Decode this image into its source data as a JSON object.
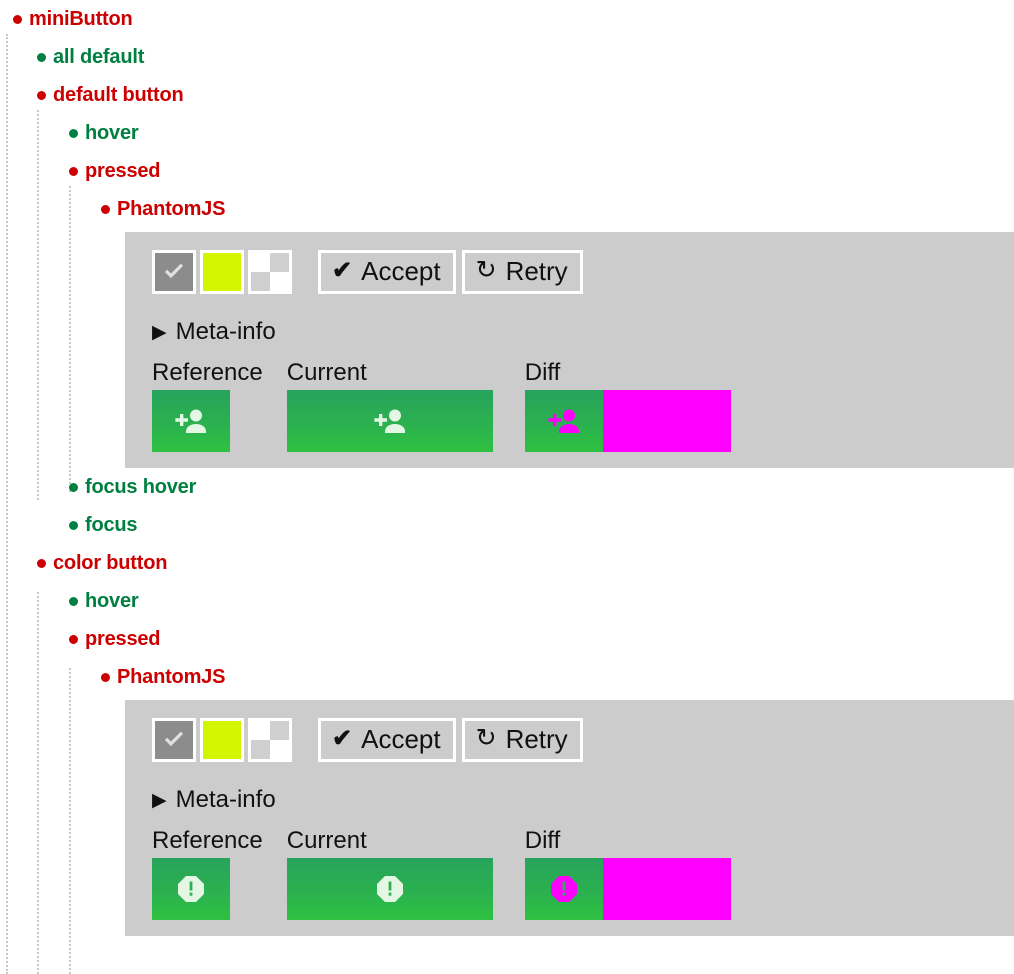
{
  "colors": {
    "fail": "#cc0000",
    "pass": "#008040",
    "panel_bg": "#cccccc",
    "diff_highlight": "#ff00ff",
    "swatch_lime": "#d4f500",
    "swatch_gray": "#8c8c8c",
    "shot_green": "#2bb14f"
  },
  "tree": {
    "root": {
      "label": "miniButton",
      "status": "fail"
    },
    "all_default": {
      "label": "all default",
      "status": "pass"
    },
    "default_button": {
      "label": "default button",
      "status": "fail"
    },
    "default_hover": {
      "label": "hover",
      "status": "pass"
    },
    "default_pressed": {
      "label": "pressed",
      "status": "fail"
    },
    "default_pressed_browser": {
      "label": "PhantomJS",
      "status": "fail"
    },
    "default_focus_hover": {
      "label": "focus hover",
      "status": "pass"
    },
    "default_focus": {
      "label": "focus",
      "status": "pass"
    },
    "color_button": {
      "label": "color button",
      "status": "fail"
    },
    "color_hover": {
      "label": "hover",
      "status": "pass"
    },
    "color_pressed": {
      "label": "pressed",
      "status": "fail"
    },
    "color_pressed_browser": {
      "label": "PhantomJS",
      "status": "fail"
    }
  },
  "panel": {
    "swatches": [
      {
        "name": "swatch-checkmark",
        "label": ""
      },
      {
        "name": "swatch-lime",
        "label": ""
      },
      {
        "name": "swatch-transparent",
        "label": ""
      }
    ],
    "accept_label": "Accept",
    "accept_glyph": "✔",
    "retry_label": "Retry",
    "retry_glyph": "↻",
    "meta_label": "Meta-info",
    "meta_arrow": "▶",
    "reference_label": "Reference",
    "current_label": "Current",
    "diff_label": "Diff"
  },
  "panels": [
    {
      "id": "default-pressed-phantomjs",
      "icon": "add-person-icon"
    },
    {
      "id": "color-pressed-phantomjs",
      "icon": "alert-octagon-icon"
    }
  ]
}
